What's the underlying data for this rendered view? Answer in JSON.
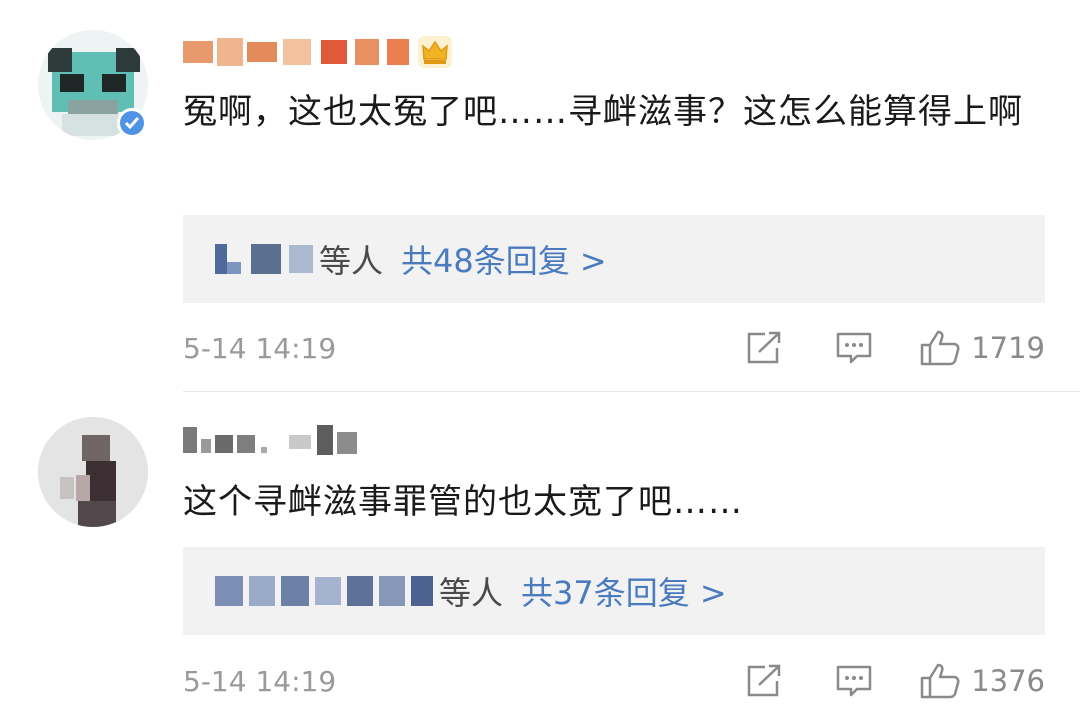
{
  "comments": [
    {
      "text": "冤啊，这也太冤了吧……寻衅滋事？这怎么能算得上啊",
      "reply": {
        "suffix": "等人",
        "count_label": "共48条回复 >"
      },
      "time": "5-14 14:19",
      "likes": "1719"
    },
    {
      "text": "这个寻衅滋事罪管的也太宽了吧……",
      "reply": {
        "suffix": "等人",
        "count_label": "共37条回复 >"
      },
      "time": "5-14 14:19",
      "likes": "1376"
    }
  ],
  "icons": {
    "share": "share-icon",
    "comment": "comment-icon",
    "like": "thumbs-up-icon",
    "crown": "crown-icon",
    "verified": "verified-icon"
  },
  "colors": {
    "link": "#4a7bbf",
    "reply_bg": "#f2f2f2",
    "meta": "#9a9a9a",
    "crown": "#f0b323",
    "verified": "#4f93e6"
  }
}
